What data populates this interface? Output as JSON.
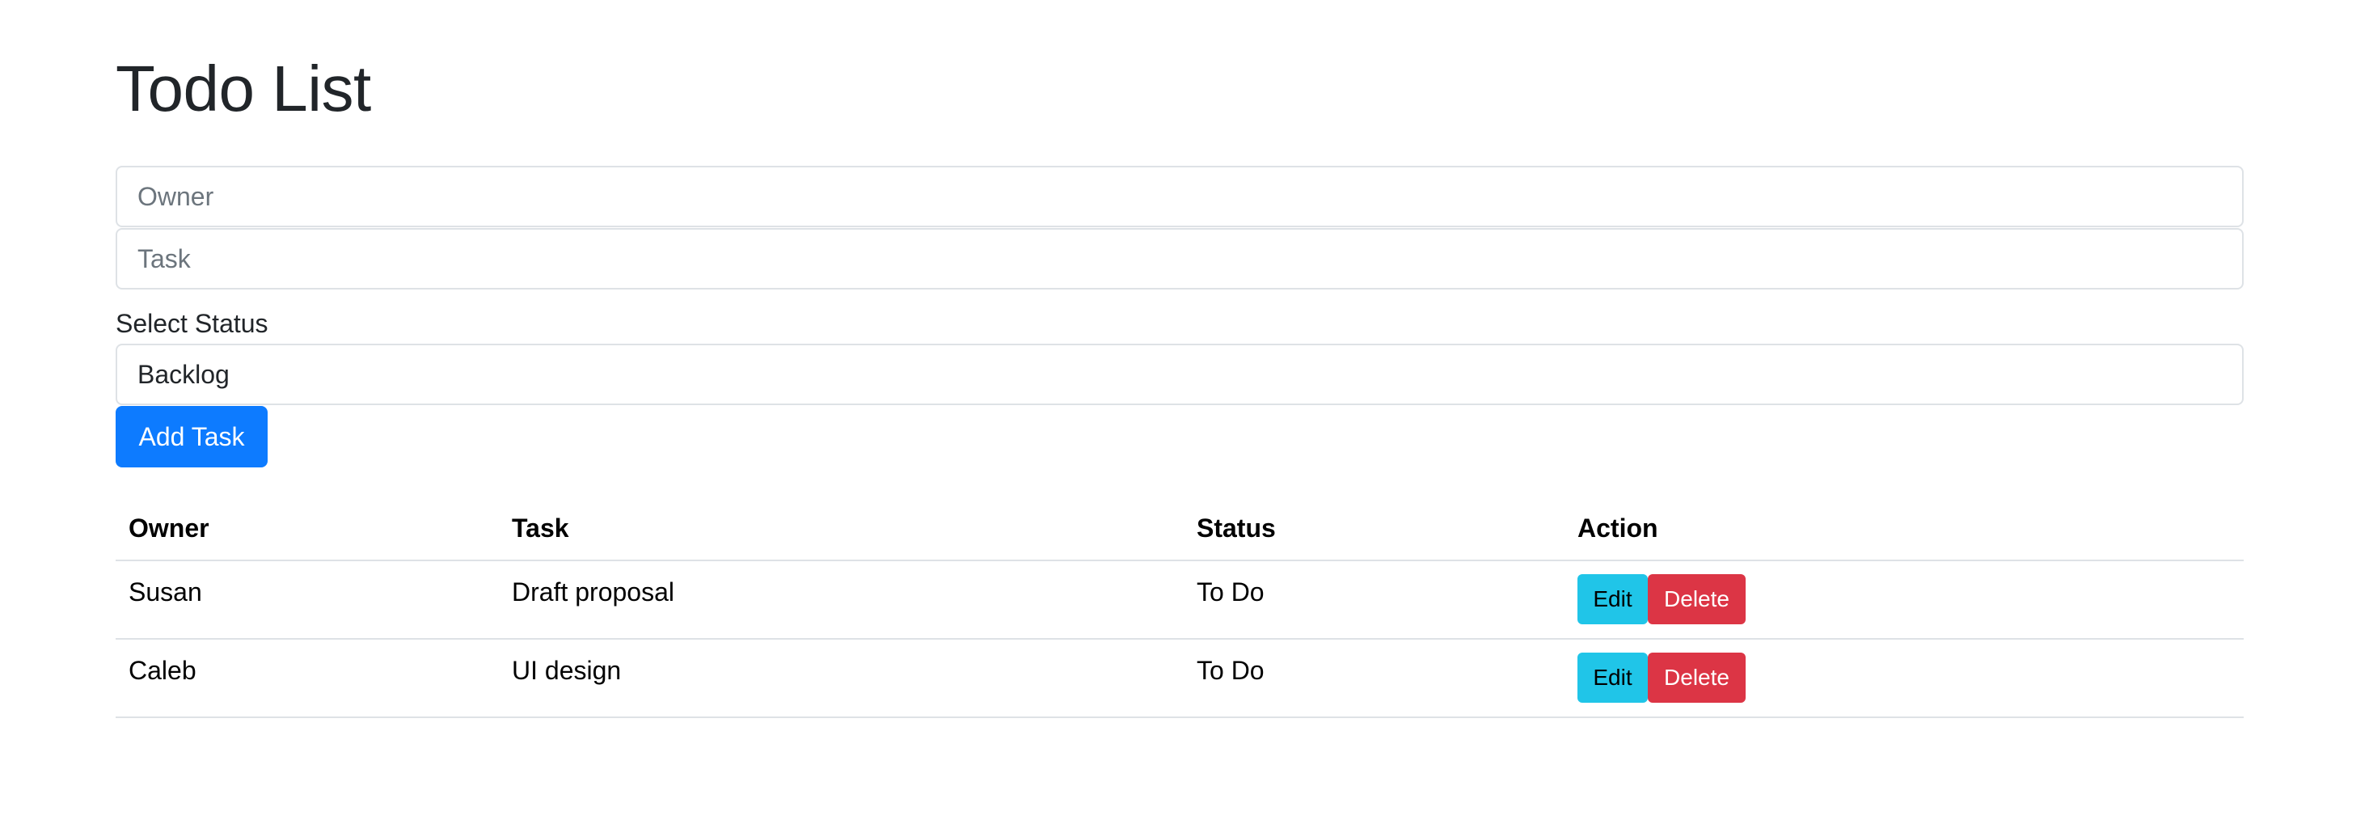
{
  "page": {
    "title": "Todo List"
  },
  "form": {
    "owner_placeholder": "Owner",
    "owner_value": "",
    "task_placeholder": "Task",
    "task_value": "",
    "status_label": "Select Status",
    "status_selected": "Backlog",
    "add_button_label": "Add Task"
  },
  "table": {
    "headers": {
      "owner": "Owner",
      "task": "Task",
      "status": "Status",
      "action": "Action"
    },
    "rows": [
      {
        "owner": "Susan",
        "task": "Draft proposal",
        "status": "To Do",
        "edit_label": "Edit",
        "delete_label": "Delete"
      },
      {
        "owner": "Caleb",
        "task": "UI design",
        "status": "To Do",
        "edit_label": "Edit",
        "delete_label": "Delete"
      }
    ]
  },
  "colors": {
    "primary": "#0d7bff",
    "info": "#20c5e8",
    "danger": "#dc3545",
    "border": "#dee2e6"
  }
}
